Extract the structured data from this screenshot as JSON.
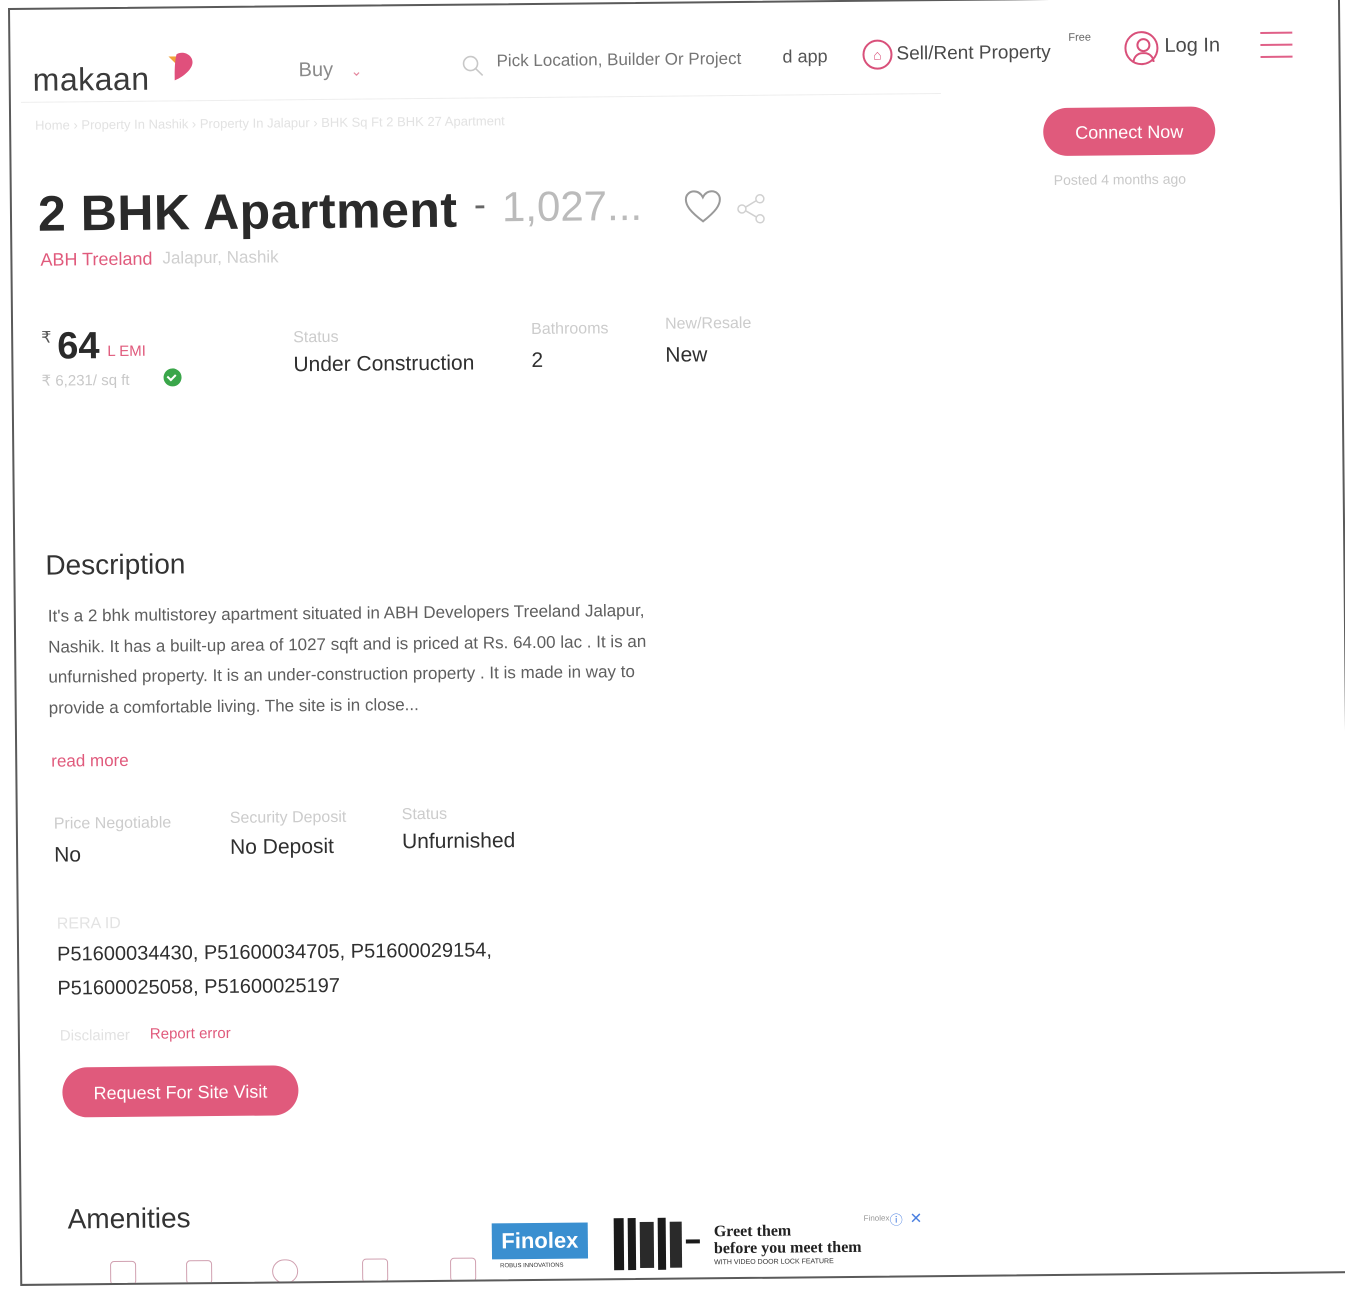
{
  "header": {
    "logo_text": "makaan",
    "buy_label": "Buy",
    "search_placeholder": "Pick Location, Builder Or Project",
    "app_text": "d app",
    "sell_label": "Sell/Rent Property",
    "sell_badge": "Free",
    "login_label": "Log In"
  },
  "breadcrumb": "Home  ›  Property In Nashik  ›  Property In Jalapur  ›  BHK Sq Ft 2 BHK 27 Apartment",
  "contact": {
    "connect_label": "Connect Now",
    "posted": "Posted 4 months ago"
  },
  "listing": {
    "title": "2 BHK Apartment",
    "title_dash": "-",
    "area_truncated": "1,027...",
    "project": "ABH Treeland",
    "locality": "Jalapur,  Nashik",
    "currency": "₹",
    "price": "64",
    "price_unit": "L  EMI",
    "rate": "₹ 6,231/ sq ft",
    "stats": [
      {
        "label": "Status",
        "value": "Under Construction"
      },
      {
        "label": "Bathrooms",
        "value": "2"
      },
      {
        "label": "New/Resale",
        "value": "New"
      }
    ]
  },
  "description": {
    "heading": "Description",
    "text": "It's a 2 bhk multistorey apartment situated in ABH Developers Treeland Jalapur, Nashik. It has a built-up area of 1027 sqft and is priced at Rs. 64.00 lac . It is an unfurnished property. It is an under-construction property . It is made in way to provide a comfortable living. The site is in close...",
    "read_more": "read more"
  },
  "details": [
    {
      "label": "Price Negotiable",
      "value": "No"
    },
    {
      "label": "Security Deposit",
      "value": "No Deposit"
    },
    {
      "label": "Status",
      "value": "Unfurnished"
    }
  ],
  "rera": {
    "label": "RERA ID",
    "value": "P51600034430, P51600034705, P51600029154, P51600025058, P51600025197"
  },
  "footer_links": {
    "disclaimer": "Disclaimer",
    "report": "Report error"
  },
  "site_visit_label": "Request For Site Visit",
  "amenities_heading": "Amenities",
  "ad": {
    "brand": "Finolex",
    "brand_tag": "ROBUS INNOVATIONS",
    "headline_1": "Greet them",
    "headline_2": "before you meet them",
    "subline": "WITH VIDEO DOOR LOCK FEATURE",
    "sponsor": "Finolex",
    "info_icon": "info-icon",
    "close_icon": "close-icon"
  },
  "colors": {
    "accent": "#e05a7c",
    "badge_green": "#3aa64a",
    "ad_blue": "#3a8fd0"
  },
  "icons": [
    "heart-logo-icon",
    "chevron-down-icon",
    "search-icon",
    "home-sell-icon",
    "user-icon",
    "hamburger-menu-icon",
    "heart-icon",
    "share-icon",
    "check-badge-icon"
  ]
}
